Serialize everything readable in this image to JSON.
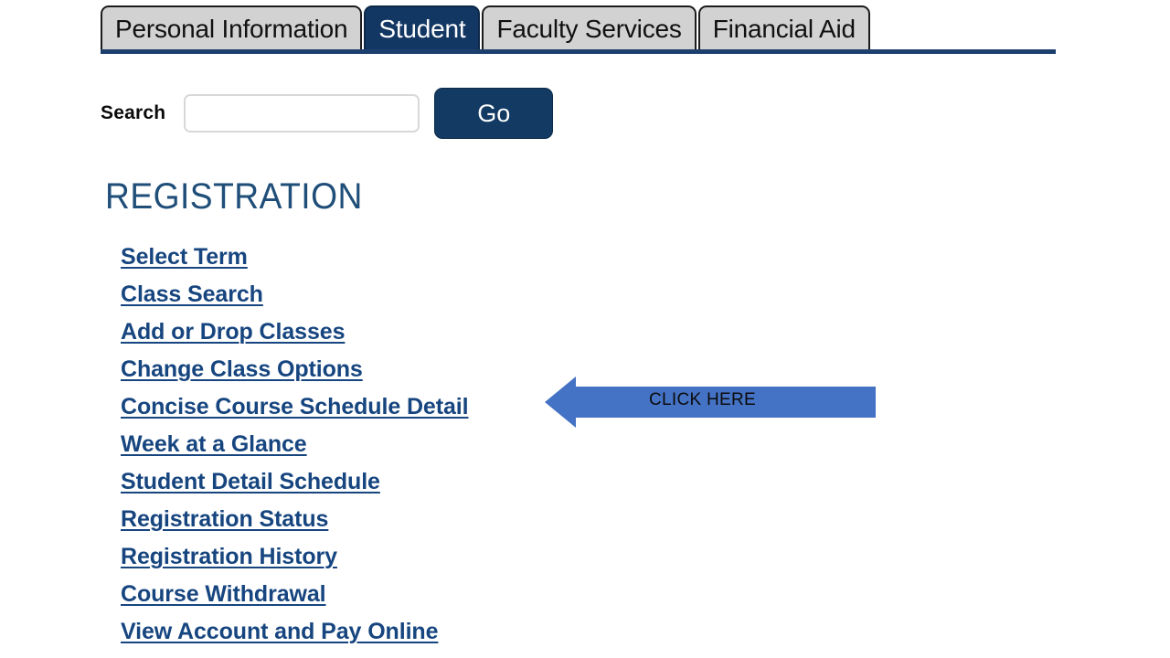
{
  "tabs": [
    {
      "label": "Personal Information",
      "active": false
    },
    {
      "label": "Student",
      "active": true
    },
    {
      "label": "Faculty Services",
      "active": false
    },
    {
      "label": "Financial Aid",
      "active": false
    }
  ],
  "search": {
    "label": "Search",
    "value": "",
    "placeholder": "",
    "go_label": "Go"
  },
  "heading": "REGISTRATION",
  "links": [
    "Select Term",
    "Class Search",
    "Add or Drop Classes",
    "Change Class Options",
    "Concise Course Schedule Detail",
    "Week at a Glance",
    "Student Detail Schedule",
    "Registration Status",
    "Registration History",
    "Course Withdrawal",
    "View Account and Pay Online"
  ],
  "callout": {
    "text": "CLICK HERE",
    "points_to": "Concise Course Schedule Detail",
    "color": "#4472C4",
    "direction": "left"
  },
  "colors": {
    "tab_active_bg": "#133763",
    "tab_inactive_bg": "#d2d2d2",
    "link_blue": "#16457f",
    "heading_blue": "#1f4e79",
    "button_navy": "#123a63",
    "arrow_blue": "#4472C4"
  }
}
